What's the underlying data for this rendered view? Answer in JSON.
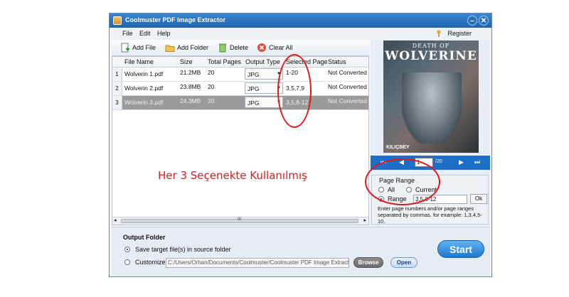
{
  "window": {
    "title": "Coolmuster PDF Image Extractor",
    "minimize": "–",
    "close": "✕"
  },
  "menu": {
    "file": "File",
    "edit": "Edit",
    "help": "Help",
    "register": "Register"
  },
  "toolbar": {
    "add_file": "Add File",
    "add_folder": "Add Folder",
    "delete": "Delete",
    "clear_all": "Clear All"
  },
  "table": {
    "headers": {
      "file_name": "File Name",
      "size": "Size",
      "total_pages": "Total Pages",
      "output_type": "Output Type",
      "selected_page": "Selected Page",
      "status": "Status"
    },
    "rows": [
      {
        "num": "1",
        "file_name": "Wolverin 1.pdf",
        "size": "21.2MB",
        "total_pages": "20",
        "output_type": "JPG",
        "selected_page": "1-20",
        "status": "Not Converted"
      },
      {
        "num": "2",
        "file_name": "Wolverin 2.pdf",
        "size": "23.8MB",
        "total_pages": "20",
        "output_type": "JPG",
        "selected_page": "3,5,7,9",
        "status": "Not Converted"
      },
      {
        "num": "3",
        "file_name": "Wolverin 3.pdf",
        "size": "24.3MB",
        "total_pages": "20",
        "output_type": "JPG",
        "selected_page": "3,5,8-12",
        "status": "Not Converted"
      }
    ],
    "scroll_mid": "III"
  },
  "overlay_text": "Her 3 Seçenekte Kullanılmış",
  "preview": {
    "cover_top": "DEATH OF",
    "cover_title": "WOLVERINE",
    "cover_sub": "",
    "cover_author": "KILIÇBEY",
    "current_page": "1",
    "total_pages": "/20"
  },
  "page_range": {
    "title": "Page Range",
    "all": "All",
    "current": "Current",
    "range": "Range",
    "range_value": "3,5,8-12",
    "ok": "Ok",
    "hint": "Enter page numbers and/or page ranges separated by commas, for example: 1,3,4,5-10."
  },
  "output": {
    "title": "Output Folder",
    "save_source": "Save target file(s) in source folder",
    "customize": "Customize",
    "path": "C:/Users/Orhan/Documents/Coolmuster/Coolmuster PDF Image Extracto",
    "browse": "Browse",
    "open": "Open",
    "start": "Start"
  },
  "colors": {
    "accent": "#1f78cc",
    "annotation": "#e01a1a",
    "selected_row": "#9a9a9a"
  }
}
